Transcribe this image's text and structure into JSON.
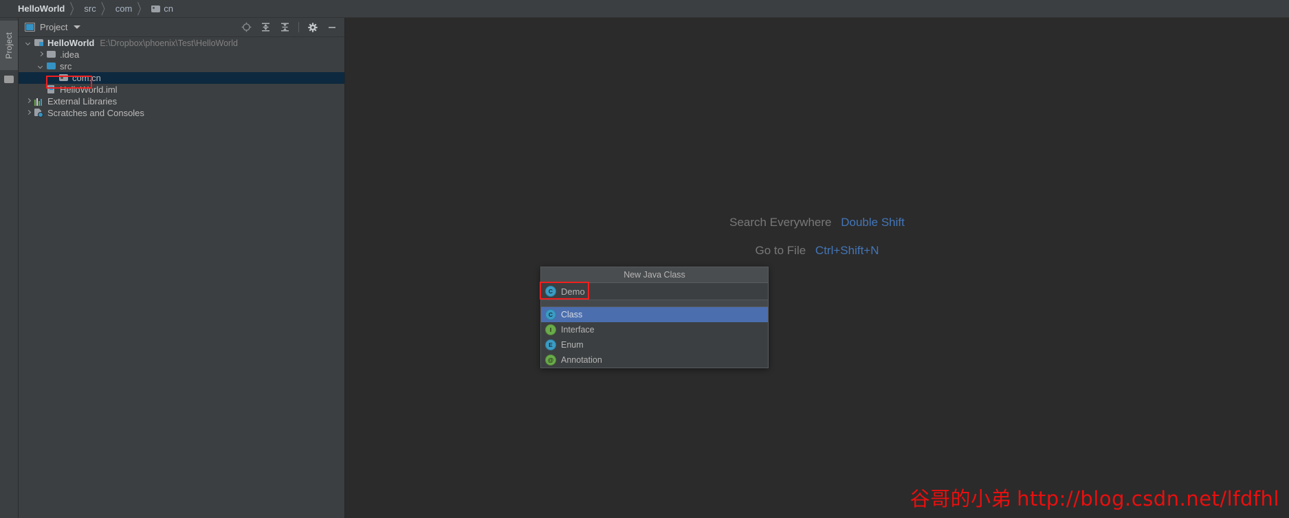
{
  "breadcrumb": {
    "items": [
      {
        "label": "HelloWorld",
        "icon": "none",
        "root": true
      },
      {
        "label": "src",
        "icon": "none",
        "root": false
      },
      {
        "label": "com",
        "icon": "none",
        "root": false
      },
      {
        "label": "cn",
        "icon": "folder-icon",
        "root": false
      }
    ],
    "separator": "〉"
  },
  "tool_strip": {
    "tab_label": "Project",
    "folder_icon": "folder-icon"
  },
  "project_panel": {
    "title": "Project",
    "title_icon": "project-window-icon",
    "caret_icon": "chevron-down-icon",
    "tools": [
      {
        "name": "locate-target-icon",
        "tooltip": "Select Opened File"
      },
      {
        "name": "expand-all-icon",
        "tooltip": "Expand All"
      },
      {
        "name": "collapse-all-icon",
        "tooltip": "Collapse All"
      },
      {
        "name": "gear-icon",
        "tooltip": "Settings"
      },
      {
        "name": "minimize-icon",
        "tooltip": "Hide"
      }
    ],
    "tree": [
      {
        "label": "HelloWorld",
        "sublabel": "E:\\Dropbox\\phoenix\\Test\\HelloWorld",
        "icon": "module-icon",
        "arrow": "down",
        "indent": 0,
        "bold": true,
        "selected": false
      },
      {
        "label": ".idea",
        "sublabel": "",
        "icon": "folder-icon",
        "arrow": "right",
        "indent": 1,
        "bold": false,
        "selected": false
      },
      {
        "label": "src",
        "sublabel": "",
        "icon": "source-folder-icon",
        "arrow": "down",
        "indent": 1,
        "bold": false,
        "selected": false
      },
      {
        "label": "com.cn",
        "sublabel": "",
        "icon": "package-icon",
        "arrow": "none",
        "indent": 2,
        "bold": false,
        "selected": true
      },
      {
        "label": "HelloWorld.iml",
        "sublabel": "",
        "icon": "iml-file-icon",
        "arrow": "none",
        "indent": 1,
        "bold": false,
        "selected": false
      },
      {
        "label": "External Libraries",
        "sublabel": "",
        "icon": "external-libraries-icon",
        "arrow": "right",
        "indent": 0,
        "bold": false,
        "selected": false
      },
      {
        "label": "Scratches and Consoles",
        "sublabel": "",
        "icon": "scratches-icon",
        "arrow": "right",
        "indent": 0,
        "bold": false,
        "selected": false
      }
    ]
  },
  "editor": {
    "hints": [
      {
        "action": "Search Everywhere",
        "shortcut": "Double Shift"
      },
      {
        "action": "Go to File",
        "shortcut": "Ctrl+Shift+N"
      }
    ]
  },
  "popup": {
    "title": "New Java Class",
    "input_value": "Demo",
    "input_placeholder": "Name",
    "input_icon": "class-icon",
    "items": [
      {
        "label": "Class",
        "icon": "class-icon",
        "glyph": "C",
        "selected": true
      },
      {
        "label": "Interface",
        "icon": "interface-icon",
        "glyph": "I",
        "selected": false
      },
      {
        "label": "Enum",
        "icon": "enum-icon",
        "glyph": "E",
        "selected": false
      },
      {
        "label": "Annotation",
        "icon": "annotation-icon",
        "glyph": "@",
        "selected": false
      }
    ]
  },
  "watermark": {
    "author": "谷哥的小弟",
    "url": "http://blog.csdn.net/lfdfhl"
  },
  "colors": {
    "panel_bg": "#3c3f41",
    "editor_bg": "#2b2b2b",
    "tree_selected_bg": "#0d293f",
    "popup_selected_bg": "#4b6eaf",
    "accent_blue": "#3592c4",
    "hint_key_blue": "#4376b8",
    "annotation_red": "#f21f1f",
    "watermark_red": "#ea0f0f",
    "text_primary": "#bbbbbb",
    "text_dim": "#808080"
  }
}
